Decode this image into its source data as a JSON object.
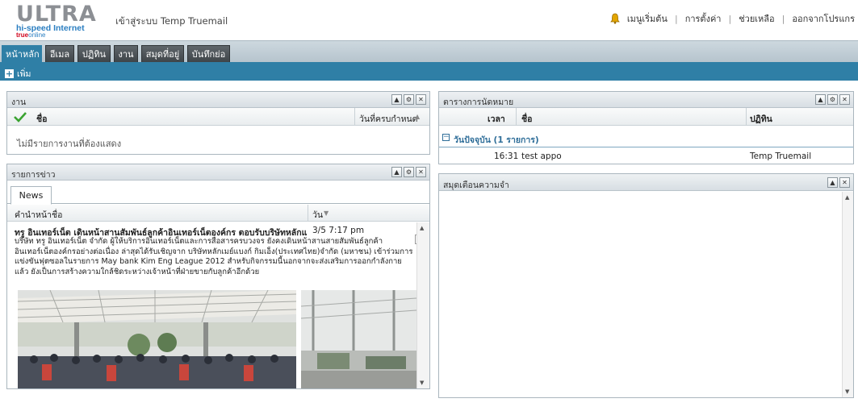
{
  "header": {
    "logo": {
      "line1": "ULTRA",
      "line2": "hi-speed Internet",
      "brand_true": "true",
      "brand_online": "online"
    },
    "login_text": "เข้าสู่ระบบ Temp Truemail",
    "links": [
      "เมนูเริ่มต้น",
      "การตั้งค่า",
      "ช่วยเหลือ",
      "ออกจากโปรแกร"
    ]
  },
  "tabs": [
    "หน้าหลัก",
    "อีเมล",
    "ปฏิทิน",
    "งาน",
    "สมุดที่อยู่",
    "บันทึกย่อ"
  ],
  "toolbar": {
    "add_label": "เพิ่ม"
  },
  "tasks": {
    "title": "งาน",
    "col_name": "ชื่อ",
    "col_due": "วันที่ครบกำหนด",
    "empty_text": "ไม่มีรายการงานที่ต้องแสดง"
  },
  "news": {
    "title": "รายการข่าว",
    "tab": "News",
    "col_headline": "คำนำหน้าชื่อ",
    "col_date": "วัน",
    "item": {
      "headline": "ทรู อินเทอร์เน็ต เดินหน้าสานสัมพันธ์ลูกค้าอินเทอร์เน็ตองค์กร ตอบรับบริษัทหลักแม่",
      "date": "3/5 7:17 pm",
      "body": "บริษัท ทรู อินเทอร์เน็ต จำกัด ผู้ให้บริการอินเทอร์เน็ตและการสื่อสารครบวงจร ยังคงเดินหน้าสานสายสัมพันธ์ลูกค้าอินเทอร์เน็ตองค์กรอย่างต่อเนื่อง ล่าสุดได้รับเชิญจาก บริษัทหลักเมย์แบงก์ กิมเอ็ง(ประเทศไทย)จำกัด (มหาชน) เข้าร่วมการแข่งขันฟุตซอลในรายการ May bank Kim Eng League 2012 สำหรับกิจกรรมนี้นอกจากจะส่งเสริมการออกกำลังกายแล้ว ยังเป็นการสร้างความใกล้ชิดระหว่างเจ้าหน้าที่ฝ่ายขายกับลูกค้าอีกด้วย"
    }
  },
  "appointments": {
    "title": "ตารางการนัดหมาย",
    "col_time": "เวลา",
    "col_name": "ชื่อ",
    "col_calendar": "ปฏิทิน",
    "group": "วันปัจจุบัน (1 รายการ)",
    "rows": [
      {
        "time": "16:31",
        "name": "test appo",
        "calendar": "Temp Truemail"
      }
    ]
  },
  "reminders": {
    "title": "สมุดเตือนความจำ"
  }
}
